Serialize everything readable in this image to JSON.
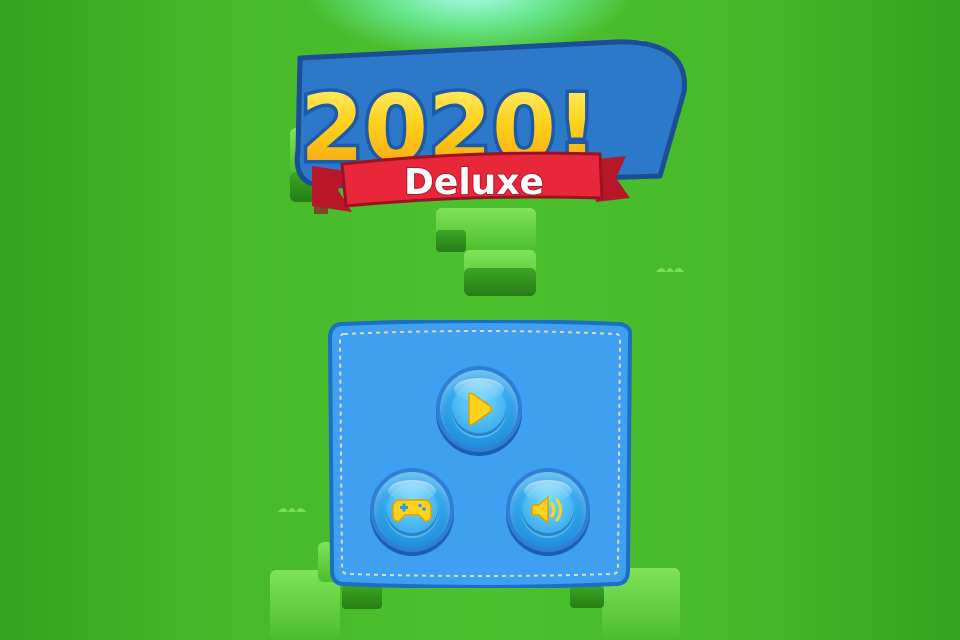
{
  "logo": {
    "title": "2020!",
    "subtitle": "Deluxe"
  },
  "menu": {
    "buttons": [
      {
        "name": "play-button",
        "icon": "play-icon"
      },
      {
        "name": "more-games-button",
        "icon": "gamepad-icon"
      },
      {
        "name": "sound-button",
        "icon": "speaker-icon"
      }
    ]
  },
  "colors": {
    "grass": "#4cc12e",
    "panel": "#3f9ff0",
    "panel_border": "#1c6fc2",
    "gold": "#ffd21c",
    "ribbon": "#e8273a",
    "button": "#2a9ee8"
  }
}
